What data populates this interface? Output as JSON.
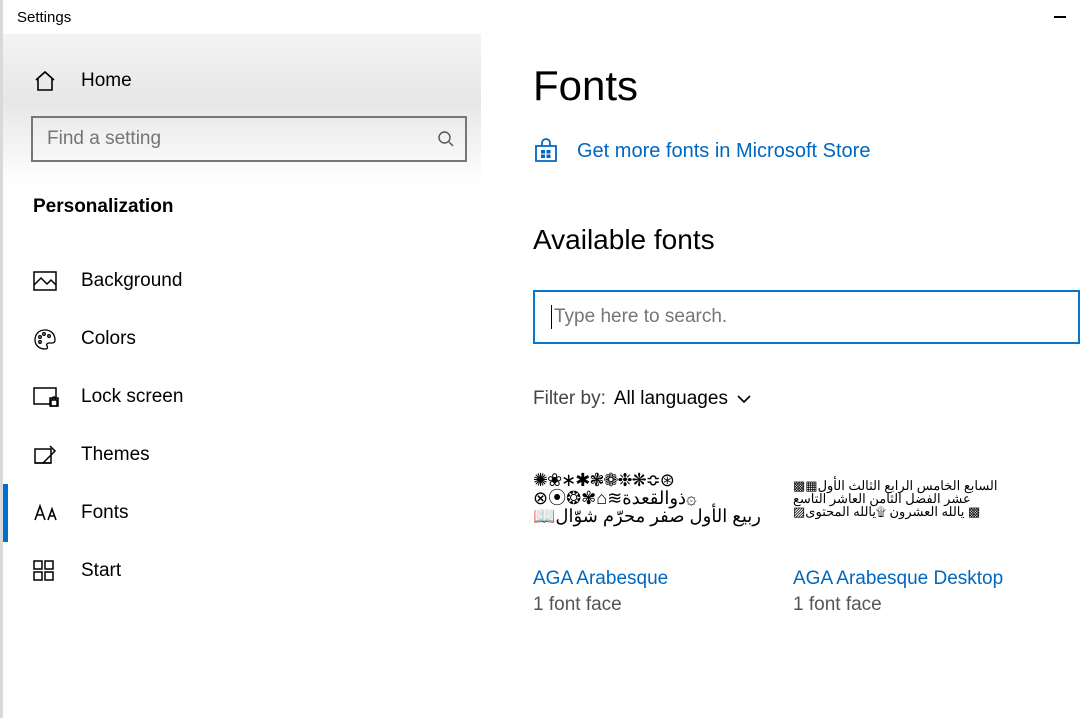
{
  "window": {
    "title": "Settings"
  },
  "sidebar": {
    "home": "Home",
    "search_placeholder": "Find a setting",
    "section": "Personalization",
    "items": [
      {
        "label": "Background"
      },
      {
        "label": "Colors"
      },
      {
        "label": "Lock screen"
      },
      {
        "label": "Themes"
      },
      {
        "label": "Fonts"
      },
      {
        "label": "Start"
      }
    ]
  },
  "main": {
    "title": "Fonts",
    "store_link": "Get more fonts in Microsoft Store",
    "available": "Available fonts",
    "font_search_placeholder": "Type here to search.",
    "filter_label": "Filter by:",
    "filter_value": "All languages",
    "cards": [
      {
        "name": "AGA Arabesque",
        "faces": "1 font face"
      },
      {
        "name": "AGA Arabesque Desktop",
        "faces": "1 font face"
      }
    ]
  }
}
